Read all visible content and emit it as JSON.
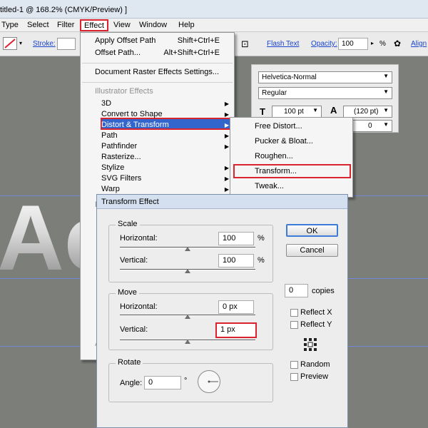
{
  "title_bar": {
    "text": "titled-1 @ 168.2% (CMYK/Preview) ]"
  },
  "menu_bar": [
    "Type",
    "Select",
    "Filter",
    "Effect",
    "View",
    "Window",
    "Help"
  ],
  "control_bar": {
    "stroke_label": "Stroke:",
    "flash_text": "Flash Text",
    "opacity_label": "Opacity:",
    "opacity_value": "100",
    "percent": "%",
    "align": "Align"
  },
  "canvas": {
    "text": "Ac"
  },
  "char_panel": {
    "font_family": "Helvetica-Normal",
    "font_style": "Regular",
    "font_size": "100 pt",
    "leading": "(120 pt)",
    "tracking": "0"
  },
  "effect_menu": {
    "apply_last": "Apply Offset Path",
    "apply_last_shortcut": "Shift+Ctrl+E",
    "last_effect": "Offset Path...",
    "last_effect_shortcut": "Alt+Shift+Ctrl+E",
    "raster_settings": "Document Raster Effects Settings...",
    "section": "Illustrator Effects",
    "items": [
      "3D",
      "Convert to Shape",
      "Distort & Transform",
      "Path",
      "Pathfinder",
      "Rasterize...",
      "Stylize",
      "SVG Filters",
      "Warp"
    ],
    "trunc_p": "P",
    "trunc_a": "A"
  },
  "distort_submenu": [
    "Free Distort...",
    "Pucker & Bloat...",
    "Roughen...",
    "Transform...",
    "Tweak..."
  ],
  "transform_dialog": {
    "title": "Transform Effect",
    "scale": {
      "label": "Scale",
      "horizontal_label": "Horizontal:",
      "horizontal": "100",
      "vertical_label": "Vertical:",
      "vertical": "100",
      "unit": "%"
    },
    "move": {
      "label": "Move",
      "horizontal_label": "Horizontal:",
      "horizontal": "0 px",
      "vertical_label": "Vertical:",
      "vertical": "1 px"
    },
    "rotate": {
      "label": "Rotate",
      "angle_label": "Angle:",
      "angle": "0",
      "degree": "°"
    },
    "ok": "OK",
    "cancel": "Cancel",
    "copies_value": "0",
    "copies_label": "copies",
    "reflect_x": "Reflect X",
    "reflect_y": "Reflect Y",
    "random": "Random",
    "preview": "Preview"
  },
  "colors": {
    "highlight_border": "#d9232e",
    "menu_selection": "#3366cc",
    "canvas_bg": "#7c7e7a"
  }
}
